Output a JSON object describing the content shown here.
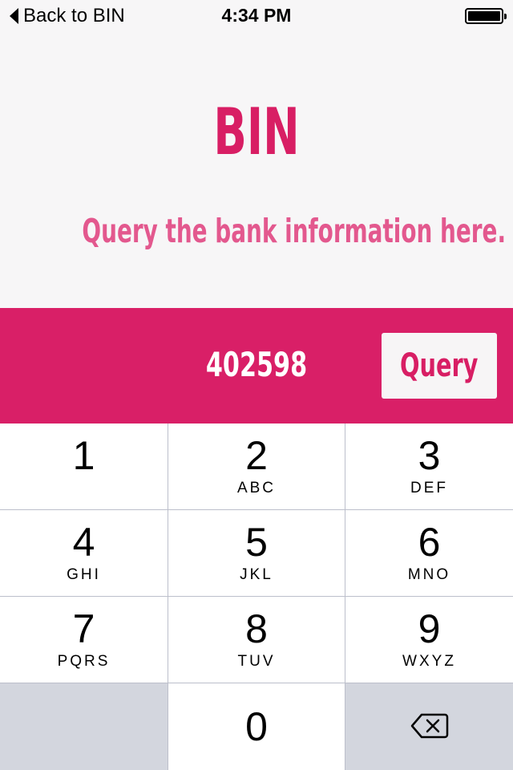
{
  "status_bar": {
    "back_label": "Back to BIN",
    "time": "4:34 PM",
    "battery_level": 1.0
  },
  "header": {
    "title": "BIN",
    "subtitle": "Query the bank information here."
  },
  "query": {
    "bin_value": "402598",
    "button_label": "Query"
  },
  "keypad": {
    "keys": [
      {
        "digit": "1",
        "letters": ""
      },
      {
        "digit": "2",
        "letters": "ABC"
      },
      {
        "digit": "3",
        "letters": "DEF"
      },
      {
        "digit": "4",
        "letters": "GHI"
      },
      {
        "digit": "5",
        "letters": "JKL"
      },
      {
        "digit": "6",
        "letters": "MNO"
      },
      {
        "digit": "7",
        "letters": "PQRS"
      },
      {
        "digit": "8",
        "letters": "TUV"
      },
      {
        "digit": "9",
        "letters": "WXYZ"
      },
      {
        "digit": "0",
        "letters": ""
      }
    ],
    "delete_icon": "backspace-icon"
  },
  "colors": {
    "accent": "#d91f67",
    "subtitle": "#e3588e",
    "background": "#f7f6f7",
    "key_dark": "#d3d6de"
  }
}
